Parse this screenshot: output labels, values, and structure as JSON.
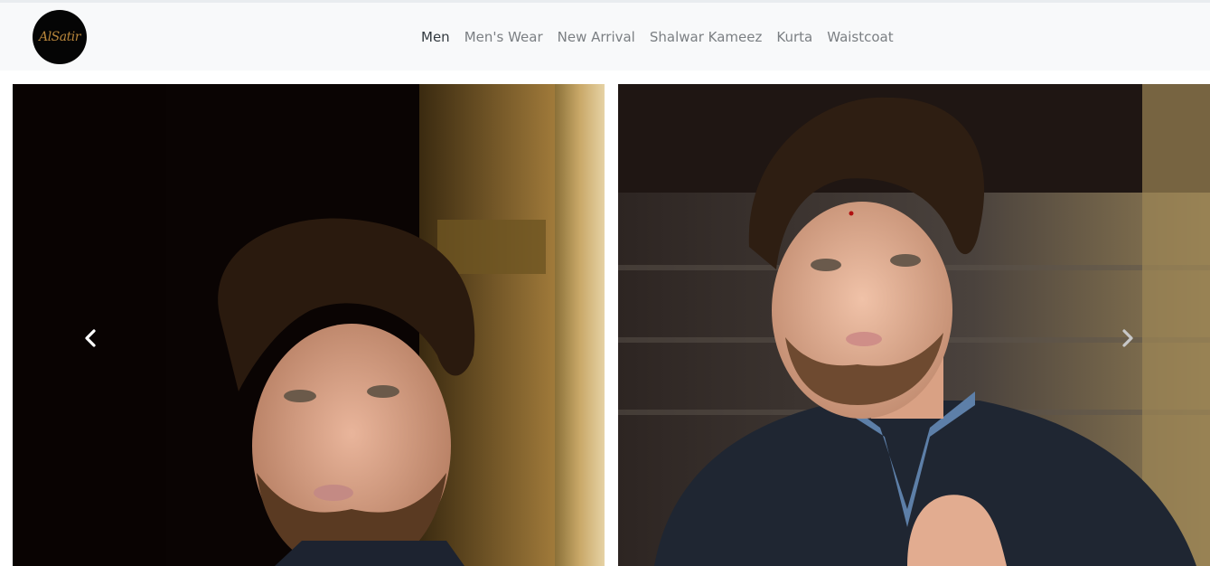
{
  "brand": {
    "logo_text": "AlSatir"
  },
  "nav": {
    "items": [
      {
        "label": "Men",
        "active": true
      },
      {
        "label": "Men's Wear",
        "active": false
      },
      {
        "label": "New Arrival",
        "active": false
      },
      {
        "label": "Shalwar Kameez",
        "active": false
      },
      {
        "label": "Kurta",
        "active": false
      },
      {
        "label": "Waistcoat",
        "active": false
      }
    ]
  },
  "carousel": {
    "controls": {
      "prev_icon": "chevron-left-icon",
      "next_icon": "chevron-right-icon"
    }
  },
  "colors": {
    "navbar_bg": "#f8f9fa",
    "nav_text": "#7b7f83",
    "nav_active": "#333a40",
    "logo_gold": "#b8863b"
  }
}
